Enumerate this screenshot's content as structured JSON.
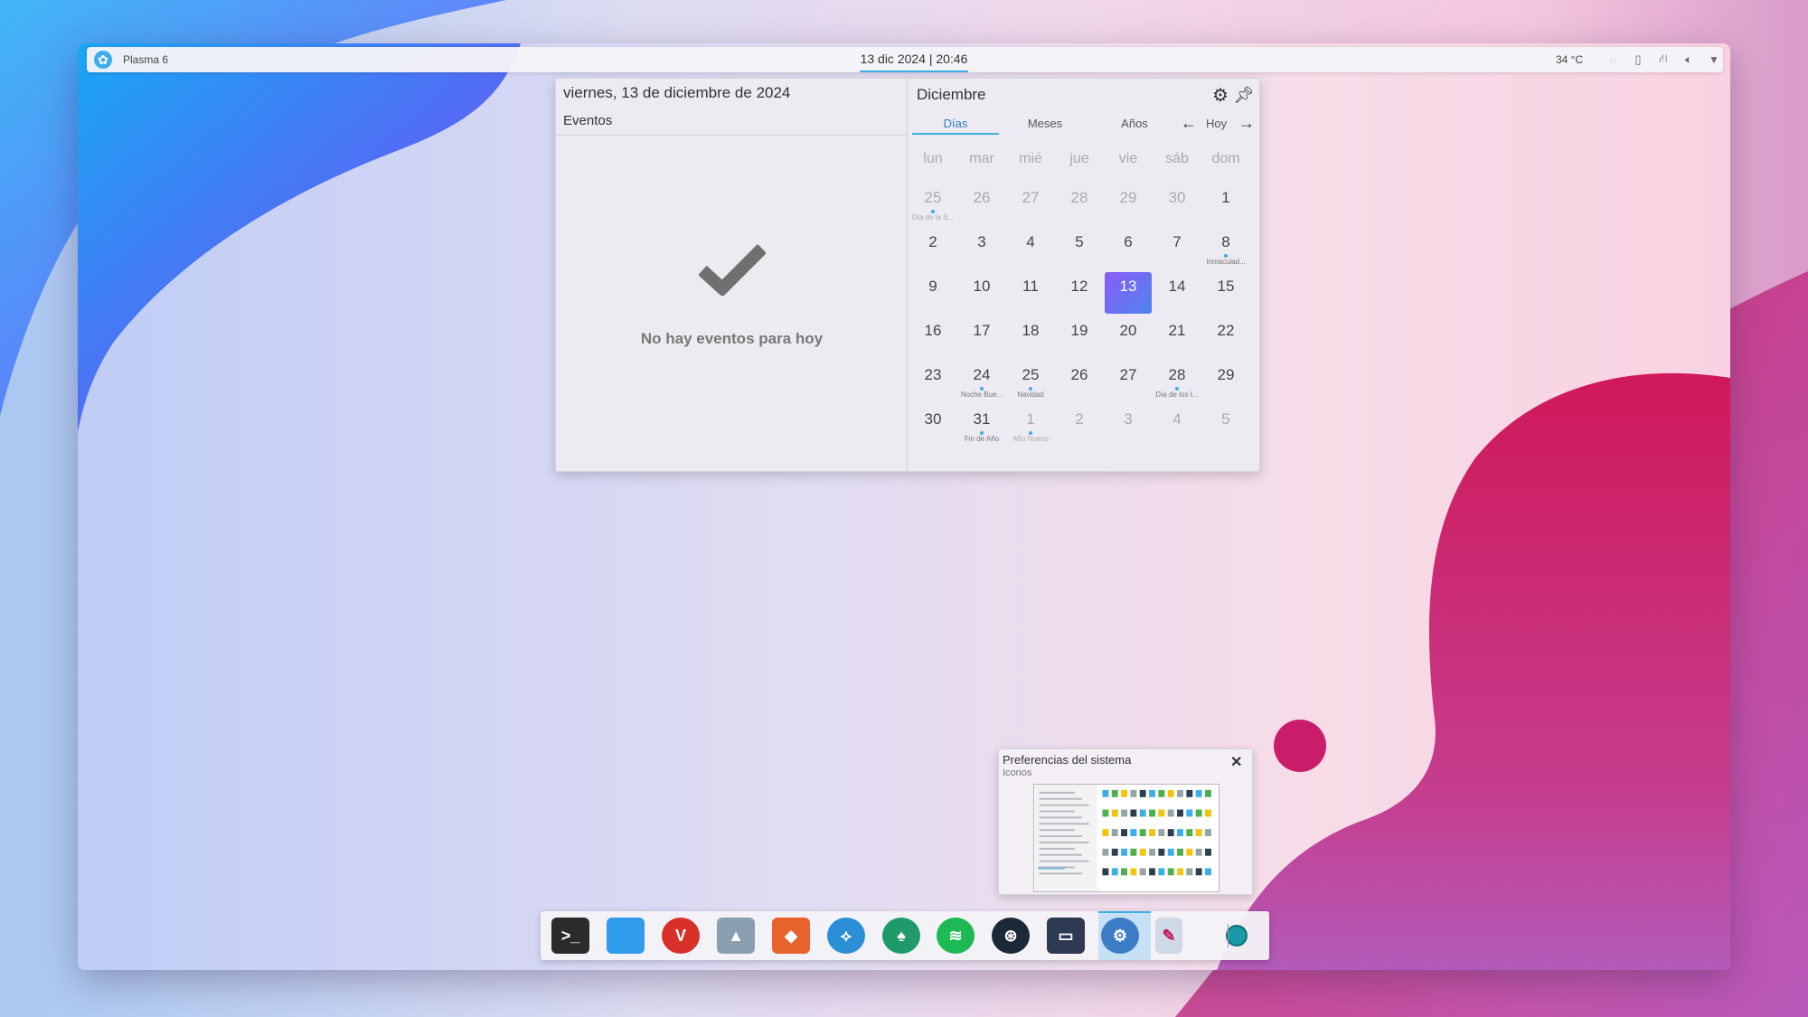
{
  "panel": {
    "app_launcher_icon": "kde-logo-icon",
    "title": "Plasma 6",
    "clock": "13 dic 2024 | 20:46",
    "temperature": "34 °C",
    "tray_icons": [
      "notifications-icon",
      "clipboard-icon",
      "network-icon",
      "volume-icon",
      "chevron-down-icon"
    ]
  },
  "calendar": {
    "full_date": "viernes, 13 de diciembre de 2024",
    "events_label": "Eventos",
    "no_events": "No hay eventos para hoy",
    "month": "Diciembre",
    "tabs": [
      "Días",
      "Meses",
      "Años"
    ],
    "active_tab": "Días",
    "today_button": "Hoy",
    "weekdays": [
      "lun",
      "mar",
      "mié",
      "jue",
      "vie",
      "sáb",
      "dom"
    ],
    "weeks": [
      [
        {
          "d": "25",
          "dim": true,
          "ev": "Día de la S..."
        },
        {
          "d": "26",
          "dim": true
        },
        {
          "d": "27",
          "dim": true
        },
        {
          "d": "28",
          "dim": true
        },
        {
          "d": "29",
          "dim": true
        },
        {
          "d": "30",
          "dim": true
        },
        {
          "d": "1"
        }
      ],
      [
        {
          "d": "2"
        },
        {
          "d": "3"
        },
        {
          "d": "4"
        },
        {
          "d": "5"
        },
        {
          "d": "6"
        },
        {
          "d": "7"
        },
        {
          "d": "8",
          "ev": "Inmaculad..."
        }
      ],
      [
        {
          "d": "9"
        },
        {
          "d": "10"
        },
        {
          "d": "11"
        },
        {
          "d": "12"
        },
        {
          "d": "13",
          "today": true
        },
        {
          "d": "14"
        },
        {
          "d": "15"
        }
      ],
      [
        {
          "d": "16"
        },
        {
          "d": "17"
        },
        {
          "d": "18"
        },
        {
          "d": "19"
        },
        {
          "d": "20"
        },
        {
          "d": "21"
        },
        {
          "d": "22"
        }
      ],
      [
        {
          "d": "23"
        },
        {
          "d": "24",
          "ev": "Noche Bue..."
        },
        {
          "d": "25",
          "ev": "Navidad"
        },
        {
          "d": "26"
        },
        {
          "d": "27"
        },
        {
          "d": "28",
          "ev": "Día de los I..."
        },
        {
          "d": "29"
        }
      ],
      [
        {
          "d": "30"
        },
        {
          "d": "31",
          "ev": "Fin de Año"
        },
        {
          "d": "1",
          "dim": true,
          "ev": "Año Nuevo"
        },
        {
          "d": "2",
          "dim": true
        },
        {
          "d": "3",
          "dim": true
        },
        {
          "d": "4",
          "dim": true
        },
        {
          "d": "5",
          "dim": true
        }
      ]
    ]
  },
  "tooltip": {
    "title": "Preferencias del sistema",
    "subtitle": "Iconos"
  },
  "dock": {
    "apps": [
      {
        "name": "terminal-icon",
        "color": "#2b2b2b",
        "glyph": ">_"
      },
      {
        "name": "files-icon",
        "color": "#2f9bea",
        "glyph": ""
      },
      {
        "name": "vivaldi-icon",
        "color": "#d8312a",
        "glyph": "V"
      },
      {
        "name": "inkscape-icon",
        "color": "#8aa0b0",
        "glyph": "▲"
      },
      {
        "name": "gitlab-icon",
        "color": "#e8622c",
        "glyph": "◆"
      },
      {
        "name": "kdeconnect-icon",
        "color": "#2a8fd6",
        "glyph": "⟡"
      },
      {
        "name": "gitkraken-icon",
        "color": "#1f9a6a",
        "glyph": "♠"
      },
      {
        "name": "spotify-icon",
        "color": "#1db954",
        "glyph": "≋"
      },
      {
        "name": "steam-icon",
        "color": "#1b2838",
        "glyph": "⊛"
      },
      {
        "name": "cassette-icon",
        "color": "#2d3a52",
        "glyph": "▭"
      },
      {
        "name": "system-settings-icon",
        "color": "#3c7bc6",
        "glyph": "⚙"
      },
      {
        "name": "color-picker-icon",
        "color": "#cfd8e6",
        "glyph": "✎"
      },
      {
        "name": "status-circle-icon",
        "color": "#1a9aa8",
        "glyph": ""
      }
    ]
  },
  "colors": {
    "accent": "#3daee9",
    "today": "#6d6ef5",
    "wallpaper_magenta": "#c2185b",
    "wallpaper_blue": "#1a9cf0"
  }
}
